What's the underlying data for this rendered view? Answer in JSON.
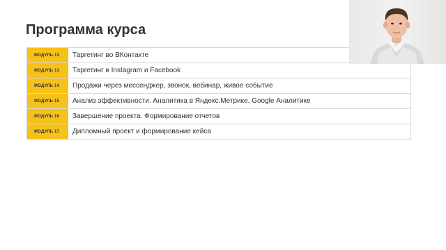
{
  "page": {
    "title": "Программа курса"
  },
  "modules": [
    {
      "code": "МОДУЛЬ 12",
      "name": "Таргетинг во ВКонтакте"
    },
    {
      "code": "МОДУЛЬ 13",
      "name": "Таргетинг в Instagram и Facebook"
    },
    {
      "code": "МОДУЛЬ 14",
      "name": "Продажи через мессенджер, звонок, вебинар, живое событие"
    },
    {
      "code": "МОДУЛЬ 15",
      "name": "Анализ эффективности. Аналитика в Яндекс.Метрике, Google Аналитике"
    },
    {
      "code": "МОДУЛЬ 16",
      "name": "Завершение проекта. Формирование отчетов"
    },
    {
      "code": "МОДУЛЬ 17",
      "name": "Дипломный проект и формирование кейса"
    }
  ],
  "colors": {
    "accent": "#f5c11a",
    "text": "#333333",
    "border": "#d9d9d9"
  },
  "webcam": {
    "icon": "presenter-video"
  }
}
